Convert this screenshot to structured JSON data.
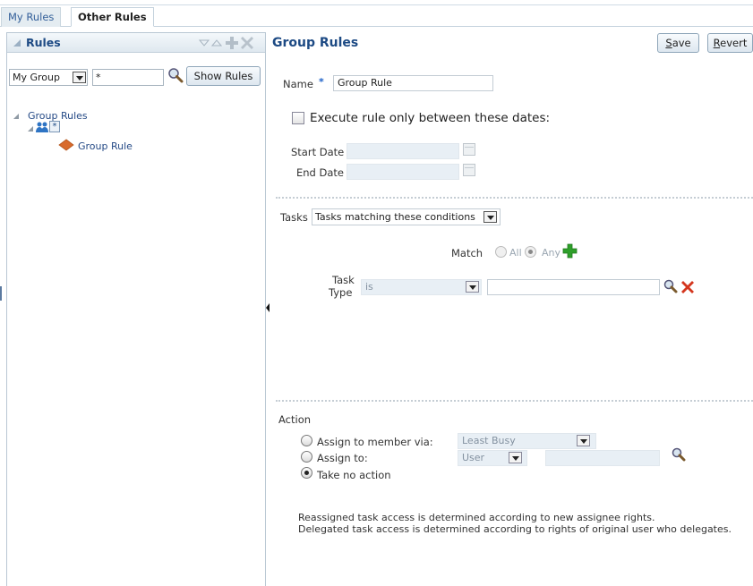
{
  "tabs": [
    {
      "label": "My Rules",
      "active": false
    },
    {
      "label": "Other Rules",
      "active": true
    }
  ],
  "left_panel": {
    "title": "Rules",
    "group_select": "My Group",
    "filter_value": "*",
    "show_rules_label": "Show Rules",
    "tree": {
      "root_label": "Group Rules",
      "group_node_label": "*",
      "rule_label": "Group Rule"
    }
  },
  "detail": {
    "title": "Group Rules",
    "save_label": "Save",
    "save_mnemonic": "S",
    "save_rest": "ave",
    "revert_label": "Revert",
    "revert_mnemonic": "R",
    "revert_rest": "evert",
    "name_label": "Name",
    "required_mark": "*",
    "name_value": "Group Rule",
    "execute_label": "Execute rule only between these dates:",
    "start_date_label": "Start Date",
    "end_date_label": "End Date",
    "tasks_label": "Tasks",
    "tasks_select": "Tasks matching these conditions",
    "match_label": "Match",
    "match_all": "All",
    "match_any": "Any",
    "condition": {
      "field_label_1": "Task",
      "field_label_2": "Type",
      "operator": "is",
      "value": ""
    },
    "action_label": "Action",
    "assign_member_label": "Assign to member via:",
    "assign_member_select": "Least Busy",
    "assign_to_label": "Assign to:",
    "assign_to_select": "User",
    "take_no_action_label": "Take no action",
    "note_line1": "Reassigned task access is determined according to new assignee rights.",
    "note_line2": "Delegated task access is determined according to rights of original user who delegates."
  },
  "colors": {
    "brand_blue": "#1d4a84",
    "plus_green": "#2e9f2a",
    "delete_red": "#d4361e"
  }
}
